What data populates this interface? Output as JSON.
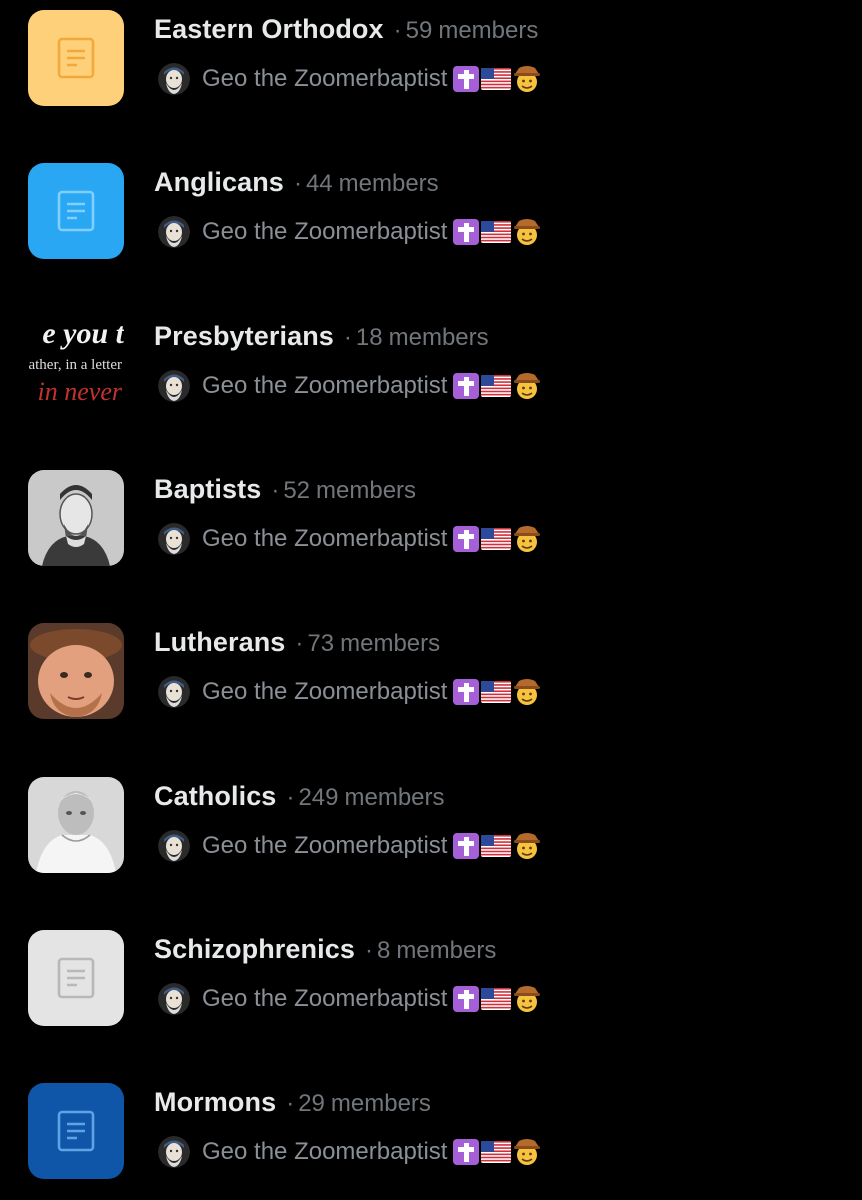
{
  "communities": [
    {
      "name": "Eastern Orthodox",
      "separator": "·",
      "count": "59",
      "count_word": "members",
      "owner": "Geo the Zoomerbaptist",
      "thumb_kind": "doc-icon",
      "thumb_color": "#ffd07a",
      "icon": "document-icon"
    },
    {
      "name": "Anglicans",
      "separator": "·",
      "count": "44",
      "count_word": "members",
      "owner": "Geo the Zoomerbaptist",
      "thumb_kind": "doc-icon",
      "thumb_color": "#2aa7f3",
      "icon": "document-icon"
    },
    {
      "name": "Presbyterians",
      "separator": "·",
      "count": "18",
      "count_word": "members",
      "owner": "Geo the Zoomerbaptist",
      "thumb_kind": "text-image",
      "thumb_text": [
        "e you t",
        "ather, in a letter",
        "in never"
      ]
    },
    {
      "name": "Baptists",
      "separator": "·",
      "count": "52",
      "count_word": "members",
      "owner": "Geo the Zoomerbaptist",
      "thumb_kind": "portrait",
      "thumb_color": "#bdbdbd",
      "icon": "engraved-portrait-icon"
    },
    {
      "name": "Lutherans",
      "separator": "·",
      "count": "73",
      "count_word": "members",
      "owner": "Geo the Zoomerbaptist",
      "thumb_kind": "face",
      "thumb_color": "#c8805c",
      "icon": "face-photo-icon"
    },
    {
      "name": "Catholics",
      "separator": "·",
      "count": "249",
      "count_word": "members",
      "owner": "Geo the Zoomerbaptist",
      "thumb_kind": "portrait-light",
      "thumb_color": "#dcdcdc",
      "icon": "pope-photo-icon"
    },
    {
      "name": "Schizophrenics",
      "separator": "·",
      "count": "8",
      "count_word": "members",
      "owner": "Geo the Zoomerbaptist",
      "thumb_kind": "doc-icon",
      "thumb_color": "#e4e4e4",
      "icon": "document-icon"
    },
    {
      "name": "Mormons",
      "separator": "·",
      "count": "29",
      "count_word": "members",
      "owner": "Geo the Zoomerbaptist",
      "thumb_kind": "doc-icon",
      "thumb_color": "#0f56a8",
      "icon": "document-icon"
    }
  ],
  "owner_badges": [
    "latin-cross-emoji",
    "us-flag-emoji",
    "cowboy-face-emoji"
  ],
  "colors": {
    "background": "#000000",
    "primary_text": "#e7e9ea",
    "secondary_text": "#71767b"
  }
}
